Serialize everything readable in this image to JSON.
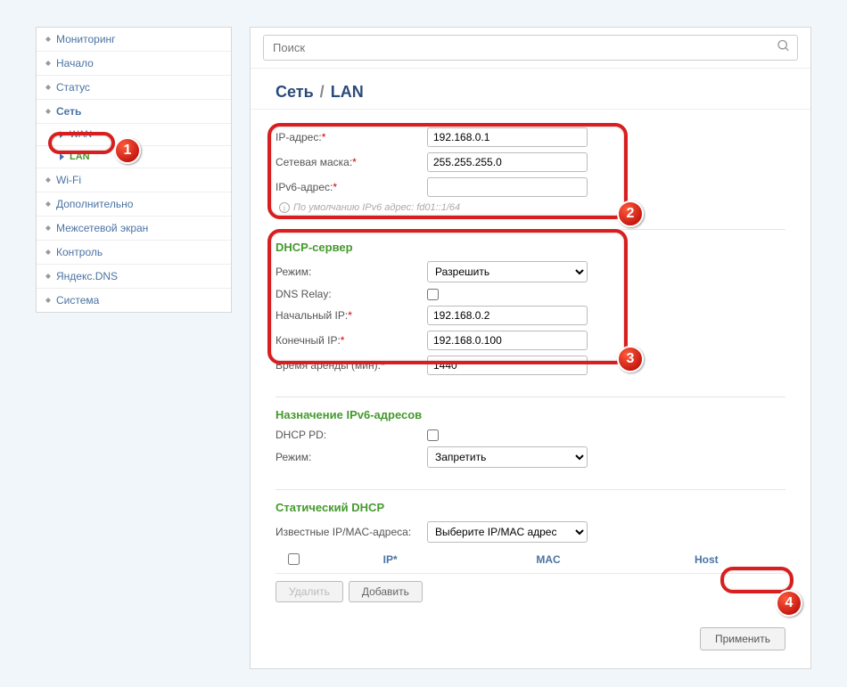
{
  "search": {
    "placeholder": "Поиск"
  },
  "breadcrumb": {
    "section": "Сеть",
    "page": "LAN"
  },
  "sidebar": {
    "items": [
      {
        "label": "Мониторинг"
      },
      {
        "label": "Начало"
      },
      {
        "label": "Статус"
      },
      {
        "label": "Сеть"
      },
      {
        "label": "WAN"
      },
      {
        "label": "LAN"
      },
      {
        "label": "Wi-Fi"
      },
      {
        "label": "Дополнительно"
      },
      {
        "label": "Межсетевой экран"
      },
      {
        "label": "Контроль"
      },
      {
        "label": "Яндекс.DNS"
      },
      {
        "label": "Система"
      }
    ]
  },
  "lan": {
    "ip_label": "IP-адрес:",
    "ip_value": "192.168.0.1",
    "mask_label": "Сетевая маска:",
    "mask_value": "255.255.255.0",
    "ipv6_label": "IPv6-адрес:",
    "ipv6_value": "",
    "ipv6_hint": "По умолчанию IPv6 адрес: fd01::1/64"
  },
  "dhcp": {
    "title": "DHCP-сервер",
    "mode_label": "Режим:",
    "mode_value": "Разрешить",
    "dns_relay_label": "DNS Relay:",
    "start_label": "Начальный IP:",
    "start_value": "192.168.0.2",
    "end_label": "Конечный IP:",
    "end_value": "192.168.0.100",
    "lease_label": "Время аренды (мин):",
    "lease_value": "1440"
  },
  "ipv6assign": {
    "title": "Назначение IPv6-адресов",
    "pd_label": "DHCP PD:",
    "mode_label": "Режим:",
    "mode_value": "Запретить"
  },
  "staticdhcp": {
    "title": "Статический DHCP",
    "known_label": "Известные IP/MAC-адреса:",
    "known_value": "Выберите IP/MAC адрес",
    "col_ip": "IP*",
    "col_mac": "MAC",
    "col_host": "Host",
    "btn_delete": "Удалить",
    "btn_add": "Добавить"
  },
  "apply": {
    "label": "Применить"
  },
  "annotations": {
    "b1": "1",
    "b2": "2",
    "b3": "3",
    "b4": "4"
  }
}
